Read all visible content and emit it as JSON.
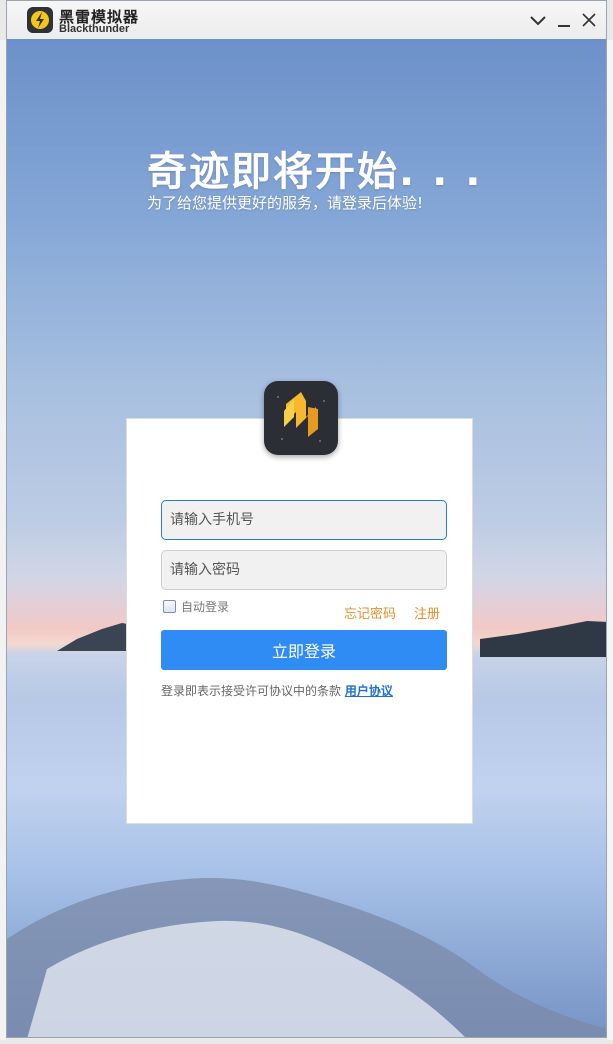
{
  "app": {
    "brand_cn": "黑雷模拟器",
    "brand_en": "Blackthunder"
  },
  "titlebar": {
    "collapse_icon": "chevron-down-icon",
    "minimize_icon": "minimize-icon",
    "close_icon": "close-icon"
  },
  "hero": {
    "headline": "奇迹即将开始. . .",
    "subline": "为了给您提供更好的服务，请登录后体验!"
  },
  "login": {
    "phone_placeholder": "请输入手机号",
    "password_placeholder": "请输入密码",
    "remember_label": "自动登录",
    "forgot_label": "忘记密码",
    "register_label": "注册",
    "submit_label": "立即登录",
    "agreement_text": "登录即表示接受许可协议中的条款",
    "agreement_link": "用户协议"
  },
  "colors": {
    "accent": "#2f8cf5",
    "link_orange": "#e28f2c",
    "link_blue": "#1f6fd0"
  }
}
